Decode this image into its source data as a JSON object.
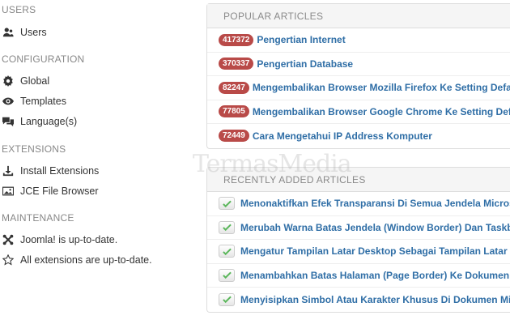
{
  "sidebar": {
    "users": {
      "title": "USERS",
      "items": [
        {
          "label": "Users",
          "icon": "user-icon"
        }
      ]
    },
    "configuration": {
      "title": "CONFIGURATION",
      "items": [
        {
          "label": "Global",
          "icon": "gear-icon"
        },
        {
          "label": "Templates",
          "icon": "eye-icon"
        },
        {
          "label": "Language(s)",
          "icon": "comments-icon"
        }
      ]
    },
    "extensions": {
      "title": "EXTENSIONS",
      "items": [
        {
          "label": "Install Extensions",
          "icon": "download-icon"
        },
        {
          "label": "JCE File Browser",
          "icon": "image-icon"
        }
      ]
    },
    "maintenance": {
      "title": "MAINTENANCE",
      "items": [
        {
          "label": "Joomla! is up-to-date.",
          "icon": "joomla-icon"
        },
        {
          "label": "All extensions are up-to-date.",
          "icon": "star-icon"
        }
      ]
    }
  },
  "popular": {
    "title": "POPULAR ARTICLES",
    "badge_color": "#b94a48",
    "rows": [
      {
        "count": "417372",
        "title": "Pengertian Internet"
      },
      {
        "count": "370337",
        "title": "Pengertian Database"
      },
      {
        "count": "82247",
        "title": "Mengembalikan Browser Mozilla Firefox Ke Setting Default"
      },
      {
        "count": "77805",
        "title": "Mengembalikan Browser Google Chrome Ke Setting Default"
      },
      {
        "count": "72449",
        "title": "Cara Mengetahui IP Address Komputer"
      }
    ]
  },
  "recent": {
    "title": "RECENTLY ADDED ARTICLES",
    "check_color": "#5bb75b",
    "rows": [
      {
        "title": "Menonaktifkan Efek Transparansi Di Semua Jendela Microsoft W"
      },
      {
        "title": "Merubah Warna Batas Jendela (Window Border) Dan Taskbar Wi"
      },
      {
        "title": "Mengatur Tampilan Latar Desktop Sebagai Tampilan Latar Start"
      },
      {
        "title": "Menambahkan Batas Halaman (Page Border) Ke Dokumen Micro"
      },
      {
        "title": "Menyisipkan Simbol Atau Karakter Khusus Di Dokumen Microso"
      }
    ]
  },
  "watermark": "TermasMedia",
  "link_color": "#2f6ea6"
}
